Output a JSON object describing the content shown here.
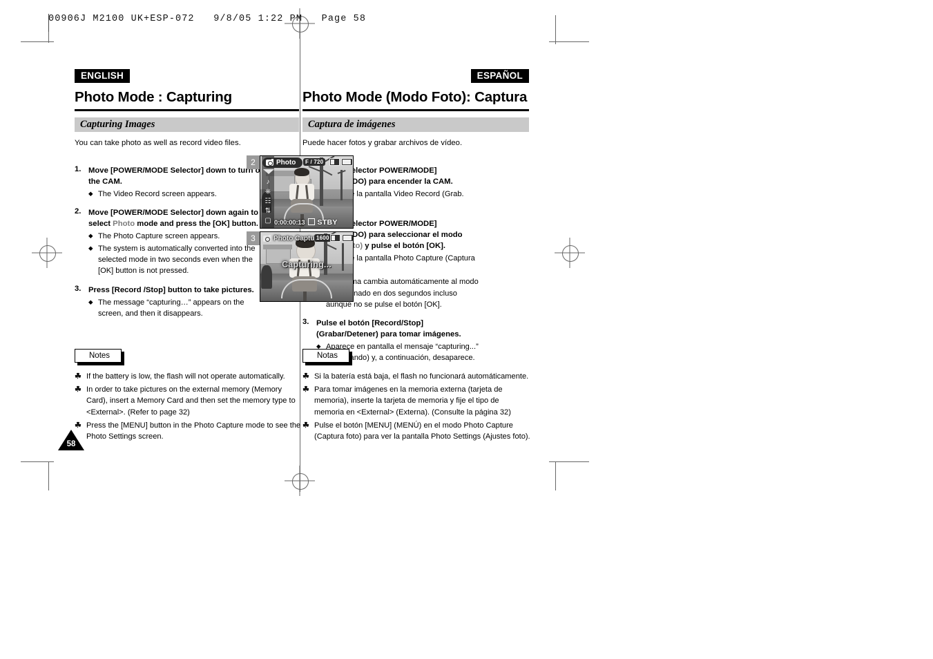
{
  "print_header": "00906J M2100 UK+ESP-072   9/8/05 1:22 PM   Page 58",
  "page_number": "58",
  "english": {
    "lang_tag": "ENGLISH",
    "title": "Photo Mode : Capturing",
    "section_bar": "Capturing Images",
    "lead": "You can take photo as well as record video files.",
    "steps": [
      {
        "num": "1.",
        "head_parts": [
          {
            "text": "Move [POWER/MODE Selector] down to turn on the CAM.",
            "style": "bold"
          }
        ],
        "bullets": [
          "The Video Record screen appears."
        ]
      },
      {
        "num": "2.",
        "head_parts": [
          {
            "text": "Move [POWER/MODE Selector] down again to select ",
            "style": "bold"
          },
          {
            "text": "Photo",
            "style": "grey"
          },
          {
            "text": " mode and press the [OK] button.",
            "style": "bold"
          }
        ],
        "bullets": [
          "The Photo Capture screen appears.",
          "The system is automatically converted into the selected mode in two seconds even when the [OK] button is not pressed."
        ]
      },
      {
        "num": "3.",
        "head_parts": [
          {
            "text": "Press [Record /Stop] button to take pictures.",
            "style": "bold"
          }
        ],
        "bullets": [
          "The message “capturing…” appears on the screen, and then it disappears."
        ]
      }
    ],
    "notes_label": "Notes",
    "notes": [
      "If the battery is low, the flash will not operate automatically.",
      "In order to take pictures on the external memory (Memory Card), insert a Memory Card and then set the memory type to <External>. (Refer to page 32)",
      "Press the [MENU] button in the Photo Capture mode to see the Photo Settings screen."
    ]
  },
  "spanish": {
    "lang_tag": "ESPAÑOL",
    "title": "Photo Mode (Modo Foto): Captura",
    "section_bar": "Captura de imágenes",
    "lead": "Puede hacer fotos y grabar archivos de vídeo.",
    "steps": [
      {
        "num": "1.",
        "head_parts": [
          {
            "text": "Baje el [Selector POWER/MODE] (ENC./MODO) para encender la CAM.",
            "style": "bold"
          }
        ],
        "bullets": [
          "Aparece la pantalla Video Record (Grab. vídeo)."
        ]
      },
      {
        "num": "2.",
        "head_parts": [
          {
            "text": "Baje el [Selector POWER/MODE] (ENC./MODO) para seleccionar el modo ",
            "style": "bold"
          },
          {
            "text": "Photo (Foto)",
            "style": "grey"
          },
          {
            "text": " y pulse el botón [OK].",
            "style": "bold"
          }
        ],
        "bullets": [
          "Aparece la pantalla Photo Capture (Captura foto).",
          "El sistema cambia automáticamente al modo seleccionado en dos segundos incluso aunque no se pulse el botón [OK]."
        ]
      },
      {
        "num": "3.",
        "head_parts": [
          {
            "text": "Pulse el  botón [Record/Stop] (Grabar/Detener) para tomar imágenes.",
            "style": "bold"
          }
        ],
        "bullets": [
          "Aparece en pantalla el mensaje “capturing...” (capturando) y, a continuación, desaparece."
        ]
      }
    ],
    "notes_label": "Notas",
    "notes": [
      "Si la batería está baja, el flash no funcionará automáticamente.",
      "Para tomar imágenes en la memoria externa (tarjeta de memoria), inserte la tarjeta de memoria y fije el tipo de memoria en <External> (Externa). (Consulte la página 32)",
      "Pulse el botón [MENU] (MENÚ) en el modo Photo Capture (Captura foto) para ver la pantalla Photo Settings (Ajustes foto)."
    ]
  },
  "screens": [
    {
      "badge": "2",
      "title": "Photo",
      "title_icon": "camera-icon",
      "rail_icons": [
        "chevron-down-icon",
        "music-note-icon",
        "microphone-icon",
        "document-icon",
        "settings-icon",
        "video-camera-icon"
      ],
      "resolution_badge": "F / 720",
      "timecode": "0:00:00:13",
      "status": "STBY",
      "status_icon": "stop-square-icon",
      "battery_icon": "battery-icon",
      "tape_icon": "tape-icon"
    },
    {
      "badge": "3",
      "title": "Photo Capture",
      "title_icon": "camera-icon",
      "resolution_badge": "1600",
      "center_message": "Capturing...",
      "battery_icon": "battery-icon",
      "tape_icon": "tape-icon"
    }
  ],
  "bullet_glyph": "◆",
  "note_glyph": "☘"
}
